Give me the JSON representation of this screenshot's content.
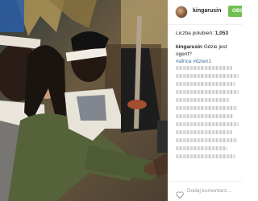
{
  "post": {
    "username": "kingarusin",
    "follow_label": "OBS",
    "likes_label": "Liczba polubień:",
    "likes_count": "1,053",
    "caption_user": "kingarusin",
    "caption_text": "Gdzie jest ogent?",
    "hashtags": "#africa #dzien1",
    "comment_placeholder": "Dodaj komentarz..."
  },
  "colors": {
    "follow_bg": "#70c050",
    "hashtag": "#3f729b"
  },
  "icons": {
    "like": "heart-icon"
  }
}
